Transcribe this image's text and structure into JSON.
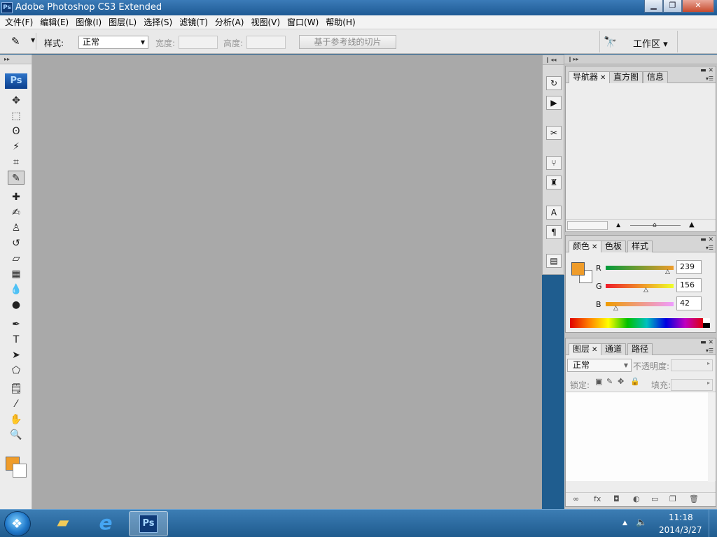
{
  "window": {
    "logo": "Ps",
    "title": "Adobe Photoshop CS3 Extended",
    "minimize": "▁",
    "maximize": "❐",
    "close": "✕"
  },
  "menu": [
    "文件(F)",
    "编辑(E)",
    "图像(I)",
    "图层(L)",
    "选择(S)",
    "滤镜(T)",
    "分析(A)",
    "视图(V)",
    "窗口(W)",
    "帮助(H)"
  ],
  "options": {
    "style_label": "样式:",
    "style_value": "正常",
    "width_label": "宽度:",
    "height_label": "高度:",
    "slice_button": "基于参考线的切片",
    "workspace_label": "工作区 ▾"
  },
  "toolbox": {
    "badge": "Ps",
    "tools": [
      {
        "name": "move-tool",
        "glyph": "✥"
      },
      {
        "name": "marquee-tool",
        "glyph": "⬚"
      },
      {
        "name": "lasso-tool",
        "glyph": "ʘ"
      },
      {
        "name": "magic-wand-tool",
        "glyph": "⚡"
      },
      {
        "name": "crop-tool",
        "glyph": "⌗"
      },
      {
        "name": "slice-tool",
        "glyph": "✎"
      },
      {
        "name": "healing-brush-tool",
        "glyph": "✚"
      },
      {
        "name": "brush-tool",
        "glyph": "✍"
      },
      {
        "name": "clone-stamp-tool",
        "glyph": "♙"
      },
      {
        "name": "history-brush-tool",
        "glyph": "↺"
      },
      {
        "name": "eraser-tool",
        "glyph": "▱"
      },
      {
        "name": "gradient-tool",
        "glyph": "▦"
      },
      {
        "name": "blur-tool",
        "glyph": "💧"
      },
      {
        "name": "dodge-tool",
        "glyph": "●"
      },
      {
        "name": "pen-tool",
        "glyph": "✒"
      },
      {
        "name": "type-tool",
        "glyph": "T"
      },
      {
        "name": "path-selection-tool",
        "glyph": "➤"
      },
      {
        "name": "shape-tool",
        "glyph": "⬠"
      },
      {
        "name": "notes-tool",
        "glyph": "🗒"
      },
      {
        "name": "eyedropper-tool",
        "glyph": "⁄"
      },
      {
        "name": "hand-tool",
        "glyph": "✋"
      },
      {
        "name": "zoom-tool",
        "glyph": "🔍"
      }
    ],
    "fg_color": "#ef9c2a",
    "bg_color": "#ffffff"
  },
  "dock": {
    "icons": [
      "history-icon",
      "actions-icon",
      "tool-presets-icon",
      "brushes-icon",
      "clone-source-icon",
      "character-icon",
      "paragraph-icon",
      "layer-comps-icon"
    ]
  },
  "panels": {
    "navigator": {
      "tabs": [
        "导航器",
        "直方图",
        "信息"
      ]
    },
    "color": {
      "tabs": [
        "颜色",
        "色板",
        "样式"
      ],
      "channels": [
        {
          "label": "R",
          "value": "239"
        },
        {
          "label": "G",
          "value": "156"
        },
        {
          "label": "B",
          "value": "42"
        }
      ],
      "fg_color": "#ef9c2a"
    },
    "layers": {
      "tabs": [
        "图层",
        "通道",
        "路径"
      ],
      "blend_mode": "正常",
      "opacity_label": "不透明度:",
      "lock_label": "锁定:",
      "fill_label": "填充:"
    }
  },
  "taskbar": {
    "time": "11:18",
    "date": "2014/3/27",
    "ps_label": "Ps"
  }
}
